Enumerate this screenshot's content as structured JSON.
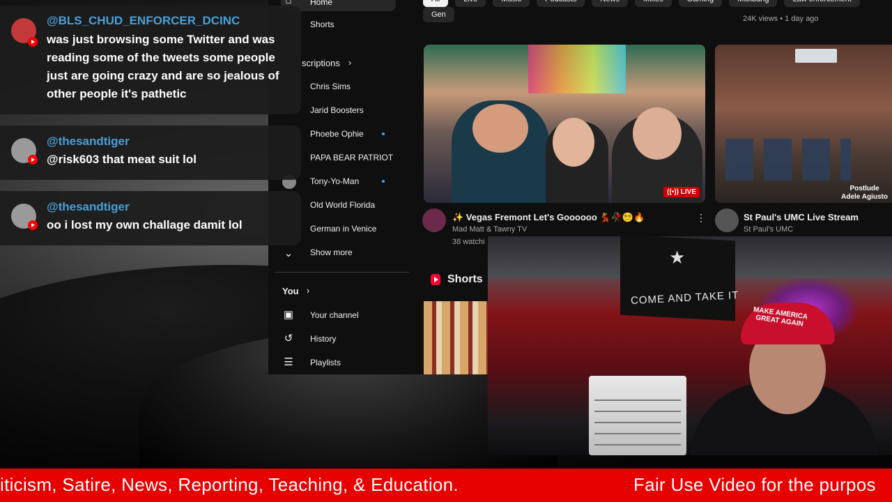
{
  "youtube": {
    "sidebar": {
      "home_label": "Home",
      "shorts_label": "Shorts",
      "subscriptions_label": "scriptions",
      "channels": [
        {
          "name": "Chris Sims",
          "new": false
        },
        {
          "name": "Jarid Boosters",
          "new": false
        },
        {
          "name": "Phoebe Ophie",
          "new": true
        },
        {
          "name": "PAPA BEAR PATRIOT",
          "new": false
        },
        {
          "name": "Tony-Yo-Man",
          "new": true
        },
        {
          "name": "Old World Florida",
          "new": false
        },
        {
          "name": "German in Venice",
          "new": false
        }
      ],
      "show_more_label": "Show more",
      "you_label": "You",
      "your_channel_label": "Your channel",
      "history_label": "History",
      "playlists_label": "Playlists"
    },
    "chips": [
      "All",
      "Live",
      "Music",
      "Podcasts",
      "News",
      "Mixes",
      "Gaming",
      "Mukbang",
      "Law enforcement",
      "Gen"
    ],
    "top_meta": "24K views • 1 day ago",
    "videos": [
      {
        "title": "✨ Vegas Fremont Let's Goooooo 💃🥀😵‍💫🔥",
        "channel": "Mad Matt & Tawny TV",
        "meta": "38 watchi",
        "badge": "LIVE"
      },
      {
        "title": "St Paul's UMC Live Stream",
        "channel": "St Paul's UMC",
        "overlay_line1": "Postlude",
        "overlay_line2": "Adele Agiusto"
      }
    ],
    "shorts_heading": "Shorts"
  },
  "webcam": {
    "flag_text": "COME AND TAKE IT",
    "hat_line1": "MAKE AMERICA",
    "hat_line2": "GREAT AGAIN"
  },
  "chat": [
    {
      "author": "@BLS_CHUD_ENFORCER_DCINC",
      "text": "was just browsing some Twitter and was reading some of the tweets some people just are going crazy and are so jealous of other people it's pathetic"
    },
    {
      "author": "@thesandtiger",
      "text": "@risk603 that meat suit lol"
    },
    {
      "author": "@thesandtiger",
      "text": "oo i lost my own challage damit lol"
    }
  ],
  "ticker": {
    "left_text": "iticism, Satire, News, Reporting, Teaching, & Education.",
    "right_text": "Fair Use Video for the purpos"
  },
  "colors": {
    "ticker_bg": "#e60000",
    "chat_author": "#4aa0d8",
    "yt_bg": "#0f0f0f",
    "live_red": "#cc0000"
  }
}
